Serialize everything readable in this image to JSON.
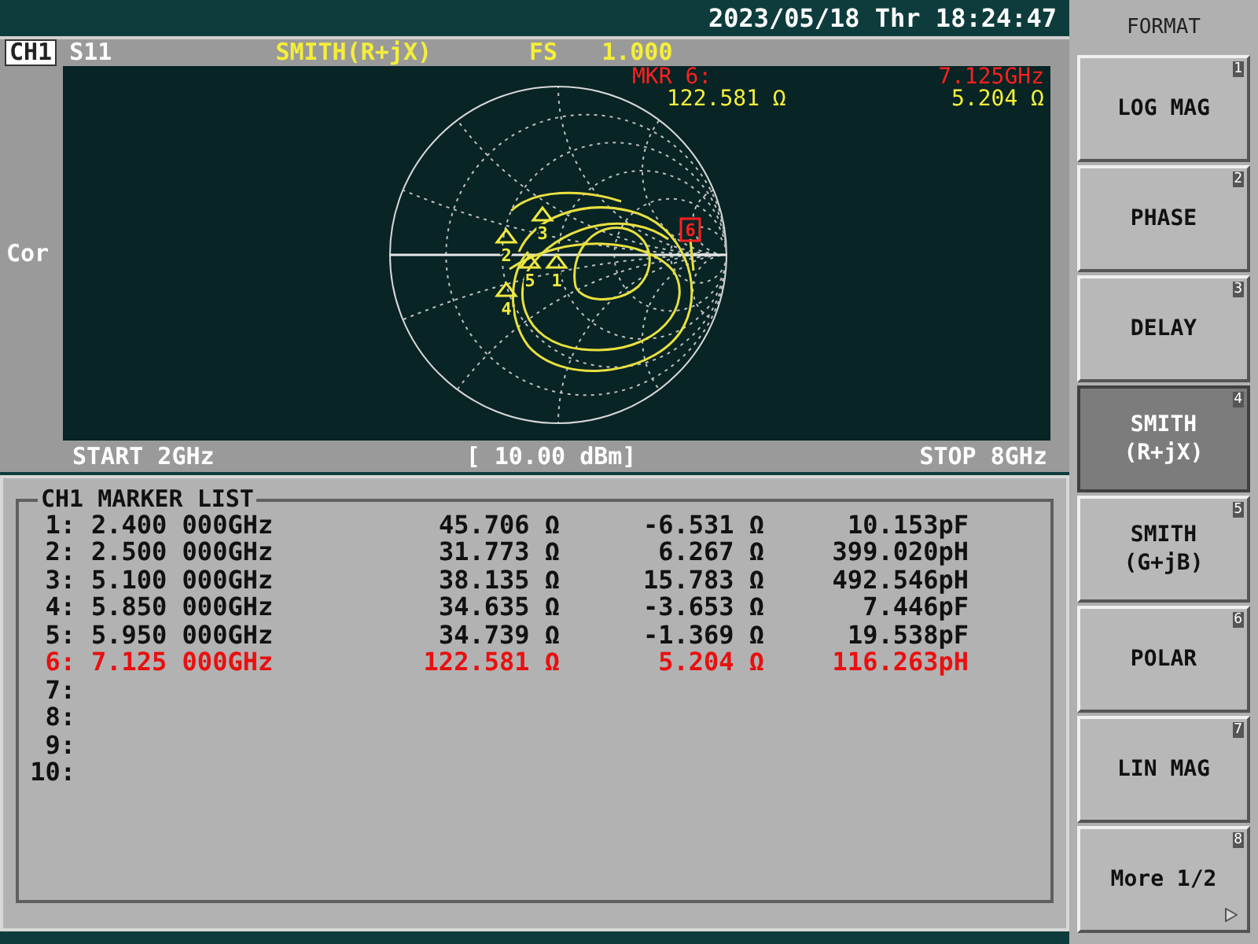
{
  "status_bar": {
    "datetime": "2023/05/18 Thr 18:24:47"
  },
  "channel_header": {
    "channel": "CH1",
    "parameter": "S11",
    "format": "SMITH(R+jX)",
    "scale_label": "FS",
    "scale_value": "1.000"
  },
  "side_label": "Cor",
  "marker_readout": {
    "label": "MKR 6:",
    "frequency": "7.125GHz",
    "resistance": "122.581 Ω",
    "reactance": "5.204 Ω"
  },
  "trace_markers": [
    {
      "label": "1",
      "active": false
    },
    {
      "label": "2",
      "active": false
    },
    {
      "label": "3",
      "active": false
    },
    {
      "label": "4",
      "active": false
    },
    {
      "label": "5",
      "active": false
    },
    {
      "label": "6",
      "active": true
    }
  ],
  "sweep_bar": {
    "start": "START 2GHz",
    "power": "[ 10.00 dBm]",
    "stop": "STOP 8GHz"
  },
  "marker_list": {
    "title": "CH1 MARKER LIST",
    "rows": [
      {
        "index": "1:",
        "frequency": "2.400 000GHz",
        "resistance": "45.706 Ω",
        "reactance": "-6.531 Ω",
        "equivalent": "10.153pF",
        "active": false
      },
      {
        "index": "2:",
        "frequency": "2.500 000GHz",
        "resistance": "31.773 Ω",
        "reactance": "6.267 Ω",
        "equivalent": "399.020pH",
        "active": false
      },
      {
        "index": "3:",
        "frequency": "5.100 000GHz",
        "resistance": "38.135 Ω",
        "reactance": "15.783 Ω",
        "equivalent": "492.546pH",
        "active": false
      },
      {
        "index": "4:",
        "frequency": "5.850 000GHz",
        "resistance": "34.635 Ω",
        "reactance": "-3.653 Ω",
        "equivalent": "7.446pF",
        "active": false
      },
      {
        "index": "5:",
        "frequency": "5.950 000GHz",
        "resistance": "34.739 Ω",
        "reactance": "-1.369 Ω",
        "equivalent": "19.538pF",
        "active": false
      },
      {
        "index": "6:",
        "frequency": "7.125 000GHz",
        "resistance": "122.581 Ω",
        "reactance": "5.204 Ω",
        "equivalent": "116.263pH",
        "active": true
      },
      {
        "index": "7:",
        "active": false
      },
      {
        "index": "8:",
        "active": false
      },
      {
        "index": "9:",
        "active": false
      },
      {
        "index": "10:",
        "active": false
      }
    ]
  },
  "softkey_menu": {
    "title": "FORMAT",
    "keys": [
      {
        "lines": [
          "LOG MAG"
        ],
        "number": "1",
        "selected": false,
        "submenu": false
      },
      {
        "lines": [
          "PHASE"
        ],
        "number": "2",
        "selected": false,
        "submenu": false
      },
      {
        "lines": [
          "DELAY"
        ],
        "number": "3",
        "selected": false,
        "submenu": false
      },
      {
        "lines": [
          "SMITH",
          "(R+jX)"
        ],
        "number": "4",
        "selected": true,
        "submenu": false
      },
      {
        "lines": [
          "SMITH",
          "(G+jB)"
        ],
        "number": "5",
        "selected": false,
        "submenu": false
      },
      {
        "lines": [
          "POLAR"
        ],
        "number": "6",
        "selected": false,
        "submenu": false
      },
      {
        "lines": [
          "LIN MAG"
        ],
        "number": "7",
        "selected": false,
        "submenu": false
      },
      {
        "lines": [
          "More 1/2"
        ],
        "number": "8",
        "selected": false,
        "submenu": true
      }
    ]
  }
}
